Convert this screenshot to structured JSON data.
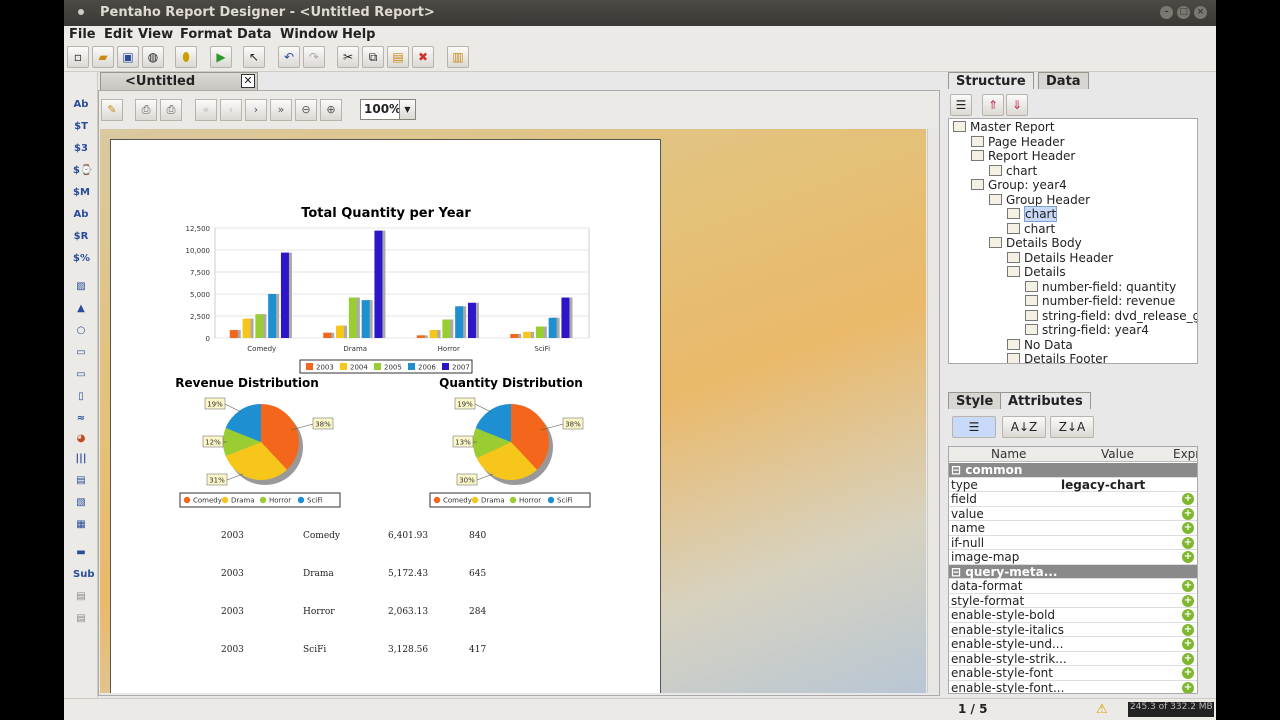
{
  "window": {
    "title": "Pentaho Report Designer - <Untitled Report>"
  },
  "menu": [
    "File",
    "Edit",
    "View",
    "Format",
    "Data",
    "Window",
    "Help"
  ],
  "document_tab": {
    "label": "<Untitled Report>"
  },
  "preview": {
    "zoom": "100%"
  },
  "report": {
    "bar_chart": {
      "title": "Total Quantity per Year",
      "categories": [
        "Comedy",
        "Drama",
        "Horror",
        "SciFi"
      ],
      "y_ticks": [
        "0",
        "2,500",
        "5,000",
        "7,500",
        "10,000",
        "12,500"
      ],
      "legend": [
        "2003",
        "2004",
        "2005",
        "2006",
        "2007"
      ]
    },
    "pie_left": {
      "title": "Revenue Distribution",
      "labels": [
        "19%",
        "38%",
        "12%",
        "31%"
      ]
    },
    "pie_right": {
      "title": "Quantity Distribution",
      "labels": [
        "19%",
        "38%",
        "13%",
        "30%"
      ]
    },
    "pie_legend": [
      "Comedy",
      "Drama",
      "Horror",
      "SciFi"
    ],
    "rows": [
      [
        "2003",
        "Comedy",
        "6,401.93",
        "840"
      ],
      [
        "2003",
        "Drama",
        "5,172.43",
        "645"
      ],
      [
        "2003",
        "Horror",
        "2,063.13",
        "284"
      ],
      [
        "2003",
        "SciFi",
        "3,128.56",
        "417"
      ]
    ]
  },
  "chart_data": [
    {
      "type": "bar",
      "title": "Total Quantity per Year",
      "categories": [
        "Comedy",
        "Drama",
        "Horror",
        "SciFi"
      ],
      "ylim": [
        0,
        12500
      ],
      "series": [
        {
          "name": "2003",
          "values": [
            900,
            600,
            300,
            450
          ]
        },
        {
          "name": "2004",
          "values": [
            2200,
            1400,
            900,
            700
          ]
        },
        {
          "name": "2005",
          "values": [
            2700,
            4600,
            2100,
            1300
          ]
        },
        {
          "name": "2006",
          "values": [
            5000,
            4300,
            3600,
            2300
          ]
        },
        {
          "name": "2007",
          "values": [
            9700,
            12200,
            4000,
            4600
          ]
        }
      ],
      "legend_position": "bottom"
    },
    {
      "type": "pie",
      "title": "Revenue Distribution",
      "labels": [
        "Comedy",
        "Drama",
        "Horror",
        "SciFi"
      ],
      "values": [
        38,
        31,
        12,
        19
      ]
    },
    {
      "type": "pie",
      "title": "Quantity Distribution",
      "labels": [
        "Comedy",
        "Drama",
        "Horror",
        "SciFi"
      ],
      "values": [
        38,
        30,
        13,
        19
      ]
    }
  ],
  "colors": {
    "series": [
      "#f4661b",
      "#f7c61a",
      "#9acd32",
      "#1e8fd0",
      "#2d16c8"
    ],
    "pie": [
      "#f4661b",
      "#f7c61a",
      "#9acd32",
      "#1e8fd0"
    ]
  },
  "right_panel": {
    "tabs": [
      "Structure",
      "Data"
    ],
    "tree": [
      {
        "label": "Master Report",
        "depth": 0
      },
      {
        "label": "Page Header",
        "depth": 1
      },
      {
        "label": "Report Header",
        "depth": 1
      },
      {
        "label": "chart",
        "depth": 2
      },
      {
        "label": "Group: year4",
        "depth": 1
      },
      {
        "label": "Group Header",
        "depth": 2
      },
      {
        "label": "chart",
        "depth": 3,
        "selected": true
      },
      {
        "label": "chart",
        "depth": 3
      },
      {
        "label": "Details Body",
        "depth": 2
      },
      {
        "label": "Details Header",
        "depth": 3
      },
      {
        "label": "Details",
        "depth": 3
      },
      {
        "label": "number-field: quantity",
        "depth": 4
      },
      {
        "label": "number-field: revenue",
        "depth": 4
      },
      {
        "label": "string-field: dvd_release_genre",
        "depth": 4
      },
      {
        "label": "string-field: year4",
        "depth": 4
      },
      {
        "label": "No Data",
        "depth": 3
      },
      {
        "label": "Details Footer",
        "depth": 3
      }
    ],
    "prop_tabs": [
      "Style",
      "Attributes"
    ],
    "columns": [
      "Name",
      "Value",
      "Expr"
    ],
    "rows": [
      {
        "group": "common"
      },
      {
        "name": "type",
        "value": "legacy-chart"
      },
      {
        "name": "field",
        "value": ""
      },
      {
        "name": "value",
        "value": ""
      },
      {
        "name": "name",
        "value": ""
      },
      {
        "name": "if-null",
        "value": ""
      },
      {
        "name": "image-map",
        "value": ""
      },
      {
        "group": "query-meta..."
      },
      {
        "name": "data-format",
        "value": ""
      },
      {
        "name": "style-format",
        "value": ""
      },
      {
        "name": "enable-style-bold",
        "value": ""
      },
      {
        "name": "enable-style-italics",
        "value": ""
      },
      {
        "name": "enable-style-und...",
        "value": ""
      },
      {
        "name": "enable-style-strik...",
        "value": ""
      },
      {
        "name": "enable-style-font",
        "value": ""
      },
      {
        "name": "enable-style-font...",
        "value": ""
      }
    ]
  },
  "status": {
    "page": "1 / 5",
    "memory": "245.3 of 332.2 MB"
  }
}
